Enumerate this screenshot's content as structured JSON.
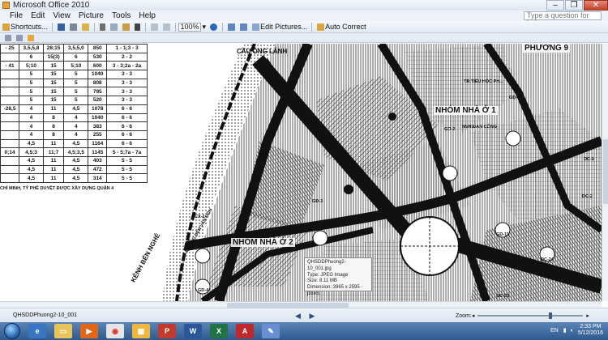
{
  "window": {
    "title": "Microsoft Office 2010",
    "buttons": [
      "–",
      "❐",
      "✕"
    ]
  },
  "menu": {
    "items": [
      "File",
      "Edit",
      "View",
      "Picture",
      "Tools",
      "Help"
    ],
    "help_placeholder": "Type a question for help"
  },
  "toolbar": {
    "shortcuts_label": "Shortcuts...",
    "zoom_value": "100%",
    "edit_pictures_label": "Edit Pictures...",
    "auto_correct_label": "Auto Correct"
  },
  "table": {
    "rows": [
      [
        "- 25",
        "3,5,5,8",
        "28;15",
        "3,5,5,0",
        "850",
        "1 - 1;3 - 3"
      ],
      [
        "",
        "6",
        "15(3)",
        "6",
        "530",
        "2 - 2"
      ],
      [
        "- 41",
        "5;10",
        "15",
        "5;10",
        "600",
        "3 - 3;2a - 2a"
      ],
      [
        "",
        "5",
        "15",
        "5",
        "1040",
        "3 - 3"
      ],
      [
        "",
        "5",
        "15",
        "5",
        "808",
        "3 - 3"
      ],
      [
        "",
        "5",
        "15",
        "5",
        "795",
        "3 - 3"
      ],
      [
        "",
        "5",
        "15",
        "5",
        "520",
        "3 - 3"
      ],
      [
        "-28,5",
        "4",
        "11",
        "4,5",
        "1078",
        "6 - 6"
      ],
      [
        "",
        "4",
        "8",
        "4",
        "1040",
        "6 - 6"
      ],
      [
        "",
        "4",
        "8",
        "4",
        "383",
        "6 - 6"
      ],
      [
        "",
        "4",
        "8",
        "4",
        "255",
        "6 - 6"
      ],
      [
        "",
        "4,5",
        "11",
        "4,5",
        "1164",
        "6 - 6"
      ],
      [
        "0;14",
        "4,5;3",
        "11;7",
        "4,5;3,5",
        "1145",
        "5 - 5;7a - 7a"
      ],
      [
        "",
        "4,5",
        "11",
        "4,5",
        "403",
        "5 - 5"
      ],
      [
        "",
        "4,5",
        "11",
        "4,5",
        "472",
        "5 - 5"
      ],
      [
        "",
        "4,5",
        "11",
        "4,5",
        "314",
        "5 - 5"
      ]
    ],
    "note": "CHÍ MINH, TỶ PHÊ DUYỆT ĐƯỢC XÂY DỰNG QUẬN 4"
  },
  "map": {
    "labels": {
      "cau_ong_lanh": "CẦU ÔNG LÃNH",
      "phuong": "PHƯỜNG 9",
      "nhom_nha_o_1": "NHÓM NHÀ Ở 1",
      "nhom_nha_o_2": "NHÓM NHÀ Ở 2",
      "kenh_ben_nghe": "KÊNH BẾN NGHÉ",
      "duong_ben_van_don": "ĐƯỜNG BẾN VÂN ĐỒN",
      "truong_tieu_hoc": "TR.TIỂU HỌC PH...",
      "gd1": "GD-1",
      "gd2": "GD-2",
      "gd3": "GD-3",
      "gd4": "GD-4",
      "cx1": "CX-1",
      "gd11": "GD-11",
      "dc24": "DC-24",
      "dc23": "DC-23",
      "dc2": "DC-2",
      "dc1": "DC-1",
      "nha_van_hoa": "NVH.ĐẠN CÔNG"
    }
  },
  "tooltip": {
    "lines": [
      "QHSDDPhuong2-10_001.jpg",
      "Type: JPEG Image",
      "Size: 8.11 MB",
      "Dimension: 3965 x 2595",
      "pixels"
    ]
  },
  "status": {
    "filename": "QHSDDPhuong2-10_001",
    "zoom_label": "Zoom:",
    "zoom_level_fraction": 0.7
  },
  "taskbar": {
    "language": "EN",
    "time": "2:33 PM",
    "date": "5/12/2016"
  },
  "colors": {
    "title_bg": "#dde6f1",
    "taskbar_bg": "#2e5a8e",
    "road": "#111111"
  }
}
